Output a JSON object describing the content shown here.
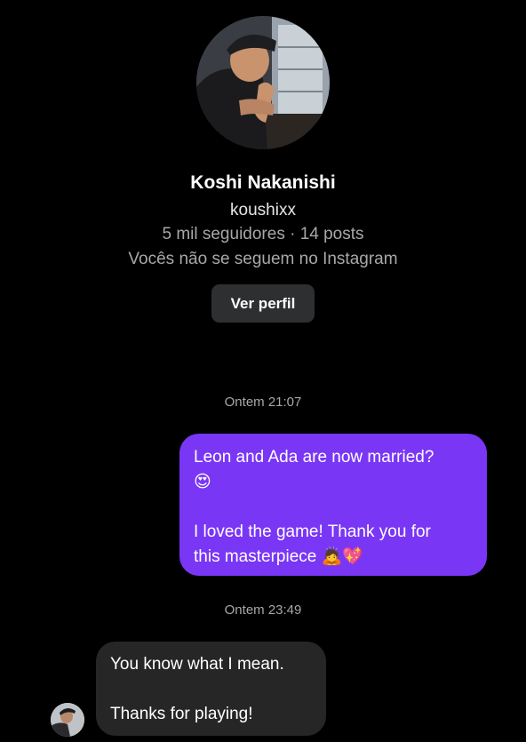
{
  "profile": {
    "name": "Koshi Nakanishi",
    "username": "koushixx",
    "stats": "5 mil seguidores · 14 posts",
    "follow_status": "Vocês não se seguem no Instagram",
    "view_profile_label": "Ver perfil",
    "avatar_icon": "profile-photo-avatar"
  },
  "thread": {
    "messages": [
      {
        "timestamp": "Ontem 21:07",
        "direction": "sent",
        "lines": [
          "Leon and Ada are now married?",
          "😍",
          "",
          "I loved the game! Thank you for",
          "this masterpiece 🙇💖"
        ]
      },
      {
        "timestamp": "Ontem 23:49",
        "direction": "received",
        "lines": [
          "You know what I mean.",
          "",
          "Thanks for playing!"
        ]
      }
    ]
  },
  "colors": {
    "background": "#000000",
    "sent_bubble": "#7a36f5",
    "received_bubble": "#262626",
    "secondary_text": "#a8a8a8",
    "button_bg": "#2e2f31"
  }
}
